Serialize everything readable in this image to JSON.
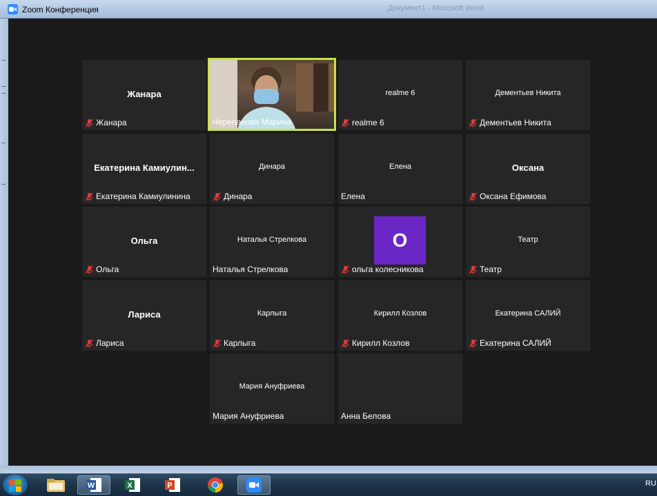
{
  "window": {
    "title": "Zoom Конференция",
    "background_text": "Документ1 - Microsoft Word"
  },
  "colors": {
    "accent_active_speaker": "#c8e34a",
    "mute_red": "#e23b3b",
    "tile_bg": "#262626",
    "avatar_bg": "#6b26c6"
  },
  "participants": [
    {
      "name": "Жанара",
      "center": "Жанара",
      "muted": true
    },
    {
      "name": "Черепанова Марина",
      "center": "",
      "muted": false,
      "video": true,
      "active": true
    },
    {
      "name": "realme 6",
      "center": "realme 6",
      "muted": true
    },
    {
      "name": "Дементьев Никита",
      "center": "Дементьев Никита",
      "muted": true
    },
    {
      "name": "Екатерина Камиулинина",
      "center": "Екатерина Камиулин...",
      "muted": true
    },
    {
      "name": "Динара",
      "center": "Динара",
      "muted": true
    },
    {
      "name": "Елена",
      "center": "Елена",
      "muted": false
    },
    {
      "name": "Оксана Ефимова",
      "center": "Оксана",
      "muted": true
    },
    {
      "name": "Ольга",
      "center": "Ольга",
      "muted": true
    },
    {
      "name": "Наталья Стрелкова",
      "center": "Наталья Стрелкова",
      "muted": false
    },
    {
      "name": "ольга колесникова",
      "center": "",
      "muted": true,
      "avatar_letter": "О"
    },
    {
      "name": "Театр",
      "center": "Театр",
      "muted": true
    },
    {
      "name": "Лариса",
      "center": "Лариса",
      "muted": true
    },
    {
      "name": "Карлыга",
      "center": "Карлыга",
      "muted": true
    },
    {
      "name": "Кирилл Козлов",
      "center": "Кирилл Козлов",
      "muted": true
    },
    {
      "name": "Екатерина САЛИЙ",
      "center": "Екатерина САЛИЙ",
      "muted": true
    },
    {
      "name": "Мария Ануфриева",
      "center": "Мария Ануфриева",
      "muted": false
    },
    {
      "name": "Анна Белова",
      "center": "",
      "muted": false
    }
  ],
  "taskbar": {
    "items": [
      "start",
      "file-explorer",
      "word",
      "excel",
      "powerpoint",
      "chrome",
      "zoom"
    ],
    "tray_text": "RU"
  }
}
